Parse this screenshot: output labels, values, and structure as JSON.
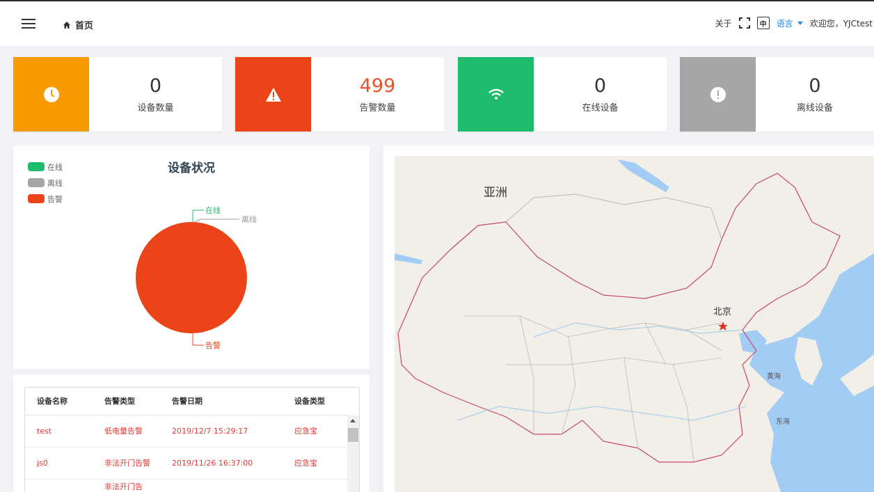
{
  "header": {
    "home_label": "首页",
    "about": "关于",
    "lang_icon_text": "中",
    "lang": "语言",
    "welcome": "欢迎您，YJCtest"
  },
  "stats": [
    {
      "value": "0",
      "label": "设备数量",
      "color": "#f89b00",
      "icon": "clock-icon"
    },
    {
      "value": "499",
      "label": "告警数量",
      "color": "#ea4418",
      "icon": "warning-icon"
    },
    {
      "value": "0",
      "label": "在线设备",
      "color": "#1ebc6c",
      "icon": "wifi-icon"
    },
    {
      "value": "0",
      "label": "离线设备",
      "color": "#a6a6a6",
      "icon": "exclamation-icon"
    }
  ],
  "status_chart": {
    "legend": [
      "在线",
      "离线",
      "告警"
    ],
    "slice_labels": [
      "在线",
      "离线",
      "告警"
    ]
  },
  "chart_data": {
    "type": "pie",
    "title": "设备状况",
    "categories": [
      "在线",
      "离线",
      "告警"
    ],
    "values": [
      0,
      0,
      499
    ],
    "colors": [
      "#1ebc6c",
      "#a6a6a6",
      "#ea4418"
    ],
    "legend_position": "top-left"
  },
  "table": {
    "columns": [
      "设备名称",
      "告警类型",
      "告警日期",
      "设备类型"
    ],
    "rows": [
      [
        "test",
        "低电量告警",
        "2019/12/7 15:29:17",
        "应急宝"
      ],
      [
        "js0",
        "非法开门告警",
        "2019/11/26 16:37:00",
        "应急宝"
      ],
      [
        "",
        "非法开门告",
        "",
        ""
      ]
    ]
  },
  "map": {
    "continent": "亚洲",
    "capital": "北京",
    "sea1": "黄海",
    "sea2": "东海"
  }
}
